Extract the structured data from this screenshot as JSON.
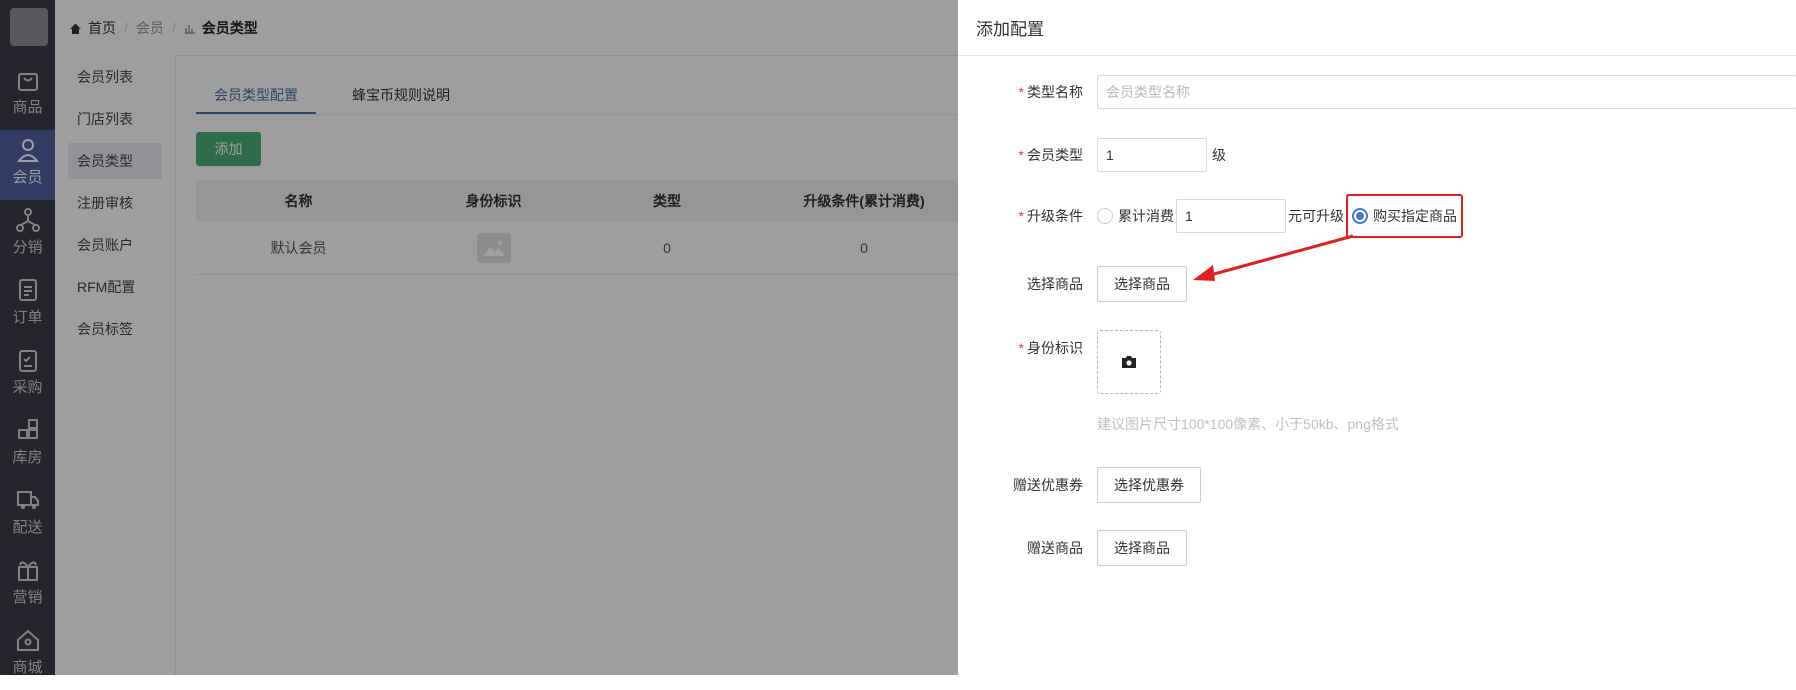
{
  "breadcrumb": {
    "home": "首页",
    "parent": "会员",
    "current": "会员类型"
  },
  "nav": [
    {
      "label": "商品",
      "icon": "bag-icon"
    },
    {
      "label": "会员",
      "icon": "user-icon",
      "active": true
    },
    {
      "label": "分销",
      "icon": "network-icon"
    },
    {
      "label": "订单",
      "icon": "document-icon"
    },
    {
      "label": "采购",
      "icon": "clipboard-icon"
    },
    {
      "label": "库房",
      "icon": "boxes-icon"
    },
    {
      "label": "配送",
      "icon": "truck-icon"
    },
    {
      "label": "营销",
      "icon": "gift-icon"
    },
    {
      "label": "商城",
      "icon": "house-icon"
    }
  ],
  "submenu": [
    "会员列表",
    "门店列表",
    "会员类型",
    "注册审核",
    "会员账户",
    "RFM配置",
    "会员标签"
  ],
  "tabs": [
    "会员类型配置",
    "蜂宝币规则说明"
  ],
  "add_button": "添加",
  "table": {
    "headers": [
      "名称",
      "身份标识",
      "类型",
      "升级条件(累计消费)"
    ],
    "rows": [
      {
        "name": "默认会员",
        "type": "0",
        "condition": "0"
      }
    ]
  },
  "drawer": {
    "title": "添加配置",
    "type_name": {
      "label": "类型名称",
      "placeholder": "会员类型名称"
    },
    "member_level": {
      "label": "会员类型",
      "value": "1",
      "suffix": "级"
    },
    "upgrade": {
      "label": "升级条件",
      "option_cumulative": "累计消费",
      "amount": "1",
      "amount_suffix": "元可升级",
      "option_buy": "购买指定商品"
    },
    "select_goods": {
      "label": "选择商品",
      "button": "选择商品"
    },
    "identity": {
      "label": "身份标识",
      "hint": "建议图片尺寸100*100像素、小于50kb、png格式"
    },
    "gift_coupon": {
      "label": "赠送优惠券",
      "button": "选择优惠券"
    },
    "gift_goods": {
      "label": "赠送商品",
      "button": "选择商品"
    }
  },
  "colors": {
    "nav_bg": "#3a3d4a",
    "nav_active": "#4f5fa0",
    "primary": "#4a78d8",
    "add_green": "#4caf7a",
    "highlight_red": "#e02020"
  }
}
